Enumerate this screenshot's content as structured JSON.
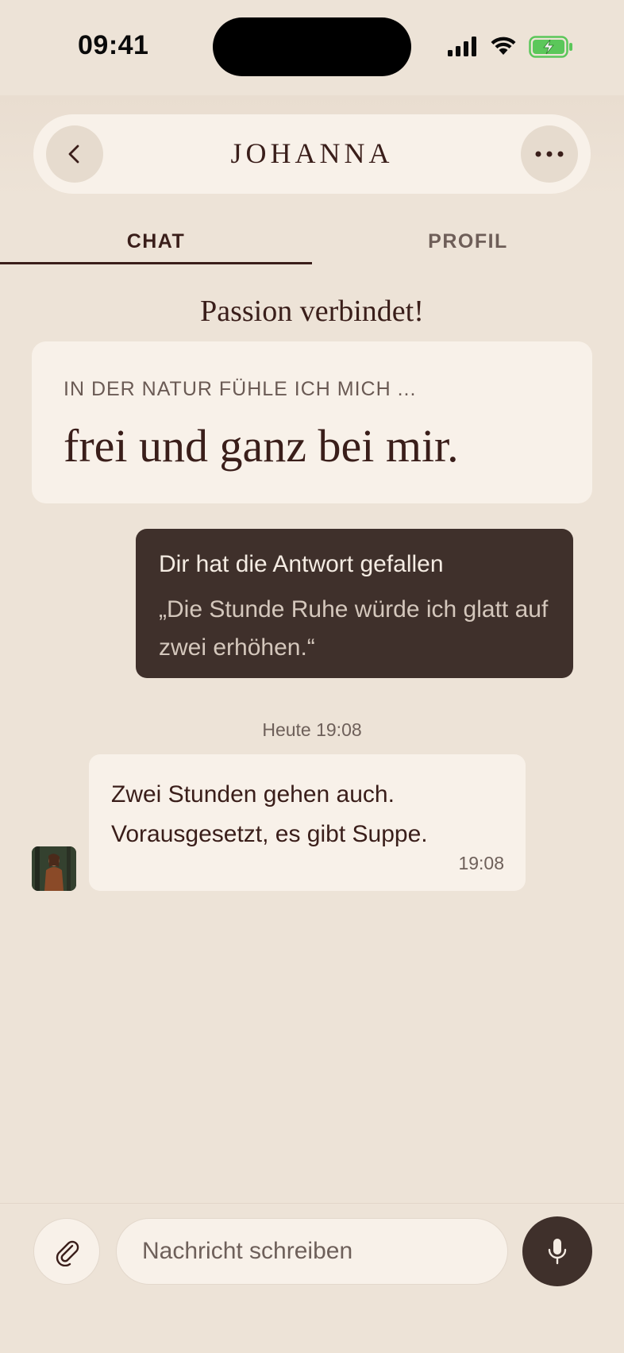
{
  "status_bar": {
    "time": "09:41",
    "icons": [
      "signal-icon",
      "wifi-icon",
      "battery-charging-icon"
    ]
  },
  "header": {
    "title": "JOHANNA",
    "back_icon": "chevron-left-icon",
    "more_icon": "more-horizontal-icon"
  },
  "tabs": [
    {
      "label": "CHAT",
      "active": true
    },
    {
      "label": "PROFIL",
      "active": false
    }
  ],
  "match_banner": "Passion verbindet!",
  "prompt": {
    "question": "IN DER NATUR FÜHLE ICH MICH ...",
    "answer": "frei und ganz bei mir."
  },
  "like_message": {
    "title": "Dir hat die Antwort gefallen",
    "quote": "„Die Stunde Ruhe würde ich glatt auf zwei erhöhen.“"
  },
  "day_separator": "Heute 19:08",
  "incoming_message": {
    "text_line1": "Zwei Stunden gehen auch.",
    "text_line2": "Vorausgesetzt, es gibt Suppe.",
    "time": "19:08"
  },
  "composer": {
    "placeholder": "Nachricht schreiben",
    "value": "",
    "attach_icon": "paperclip-icon",
    "mic_icon": "microphone-icon"
  },
  "colors": {
    "background": "#EDE3D7",
    "card": "#F8F1E9",
    "dark_bubble": "#3F302B",
    "text": "#3A1E1A",
    "battery_green": "#5BC75A"
  }
}
